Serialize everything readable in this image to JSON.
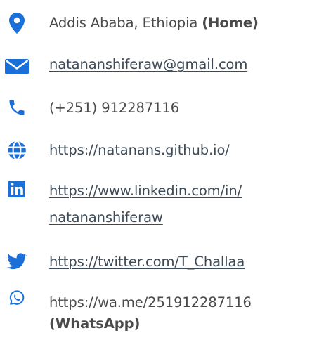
{
  "accent_color": "#1b6fd8",
  "contacts": {
    "location": {
      "icon": "map-pin-icon",
      "text": "Addis Ababa, Ethiopia",
      "suffix": "(Home)"
    },
    "email": {
      "icon": "envelope-icon",
      "text": "natananshiferaw@gmail.com"
    },
    "phone": {
      "icon": "phone-icon",
      "text": "(+251) 912287116"
    },
    "website": {
      "icon": "globe-icon",
      "text": "https://natanans.github.io/"
    },
    "linkedin": {
      "icon": "linkedin-icon",
      "line1": "https://www.linkedin.com/in/",
      "line2": "natananshiferaw"
    },
    "twitter": {
      "icon": "twitter-icon",
      "text": "https://twitter.com/T_Challaa"
    },
    "whatsapp": {
      "icon": "whatsapp-icon",
      "text": "https://wa.me/251912287116",
      "suffix": "(WhatsApp)"
    }
  }
}
